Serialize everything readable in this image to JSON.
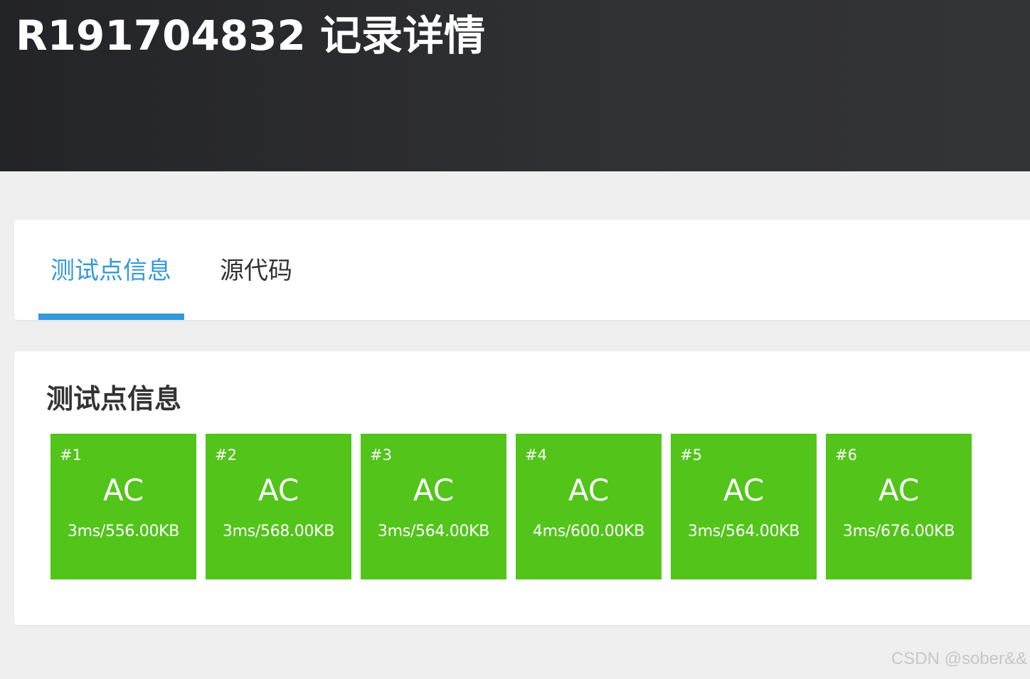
{
  "header": {
    "title": "R191704832 记录详情"
  },
  "tabs": [
    {
      "label": "测试点信息",
      "active": true
    },
    {
      "label": "源代码",
      "active": false
    }
  ],
  "section": {
    "title": "测试点信息"
  },
  "test_cases": [
    {
      "id": "#1",
      "status": "AC",
      "metric": "3ms/556.00KB"
    },
    {
      "id": "#2",
      "status": "AC",
      "metric": "3ms/568.00KB"
    },
    {
      "id": "#3",
      "status": "AC",
      "metric": "3ms/564.00KB"
    },
    {
      "id": "#4",
      "status": "AC",
      "metric": "4ms/600.00KB"
    },
    {
      "id": "#5",
      "status": "AC",
      "metric": "3ms/564.00KB"
    },
    {
      "id": "#6",
      "status": "AC",
      "metric": "3ms/676.00KB"
    }
  ],
  "watermark": "CSDN @sober&&",
  "colors": {
    "header_bg": "#2b2c2e",
    "page_bg": "#efefef",
    "accent": "#3498db",
    "ac_green": "#52c41a",
    "text_dark": "#333333"
  }
}
